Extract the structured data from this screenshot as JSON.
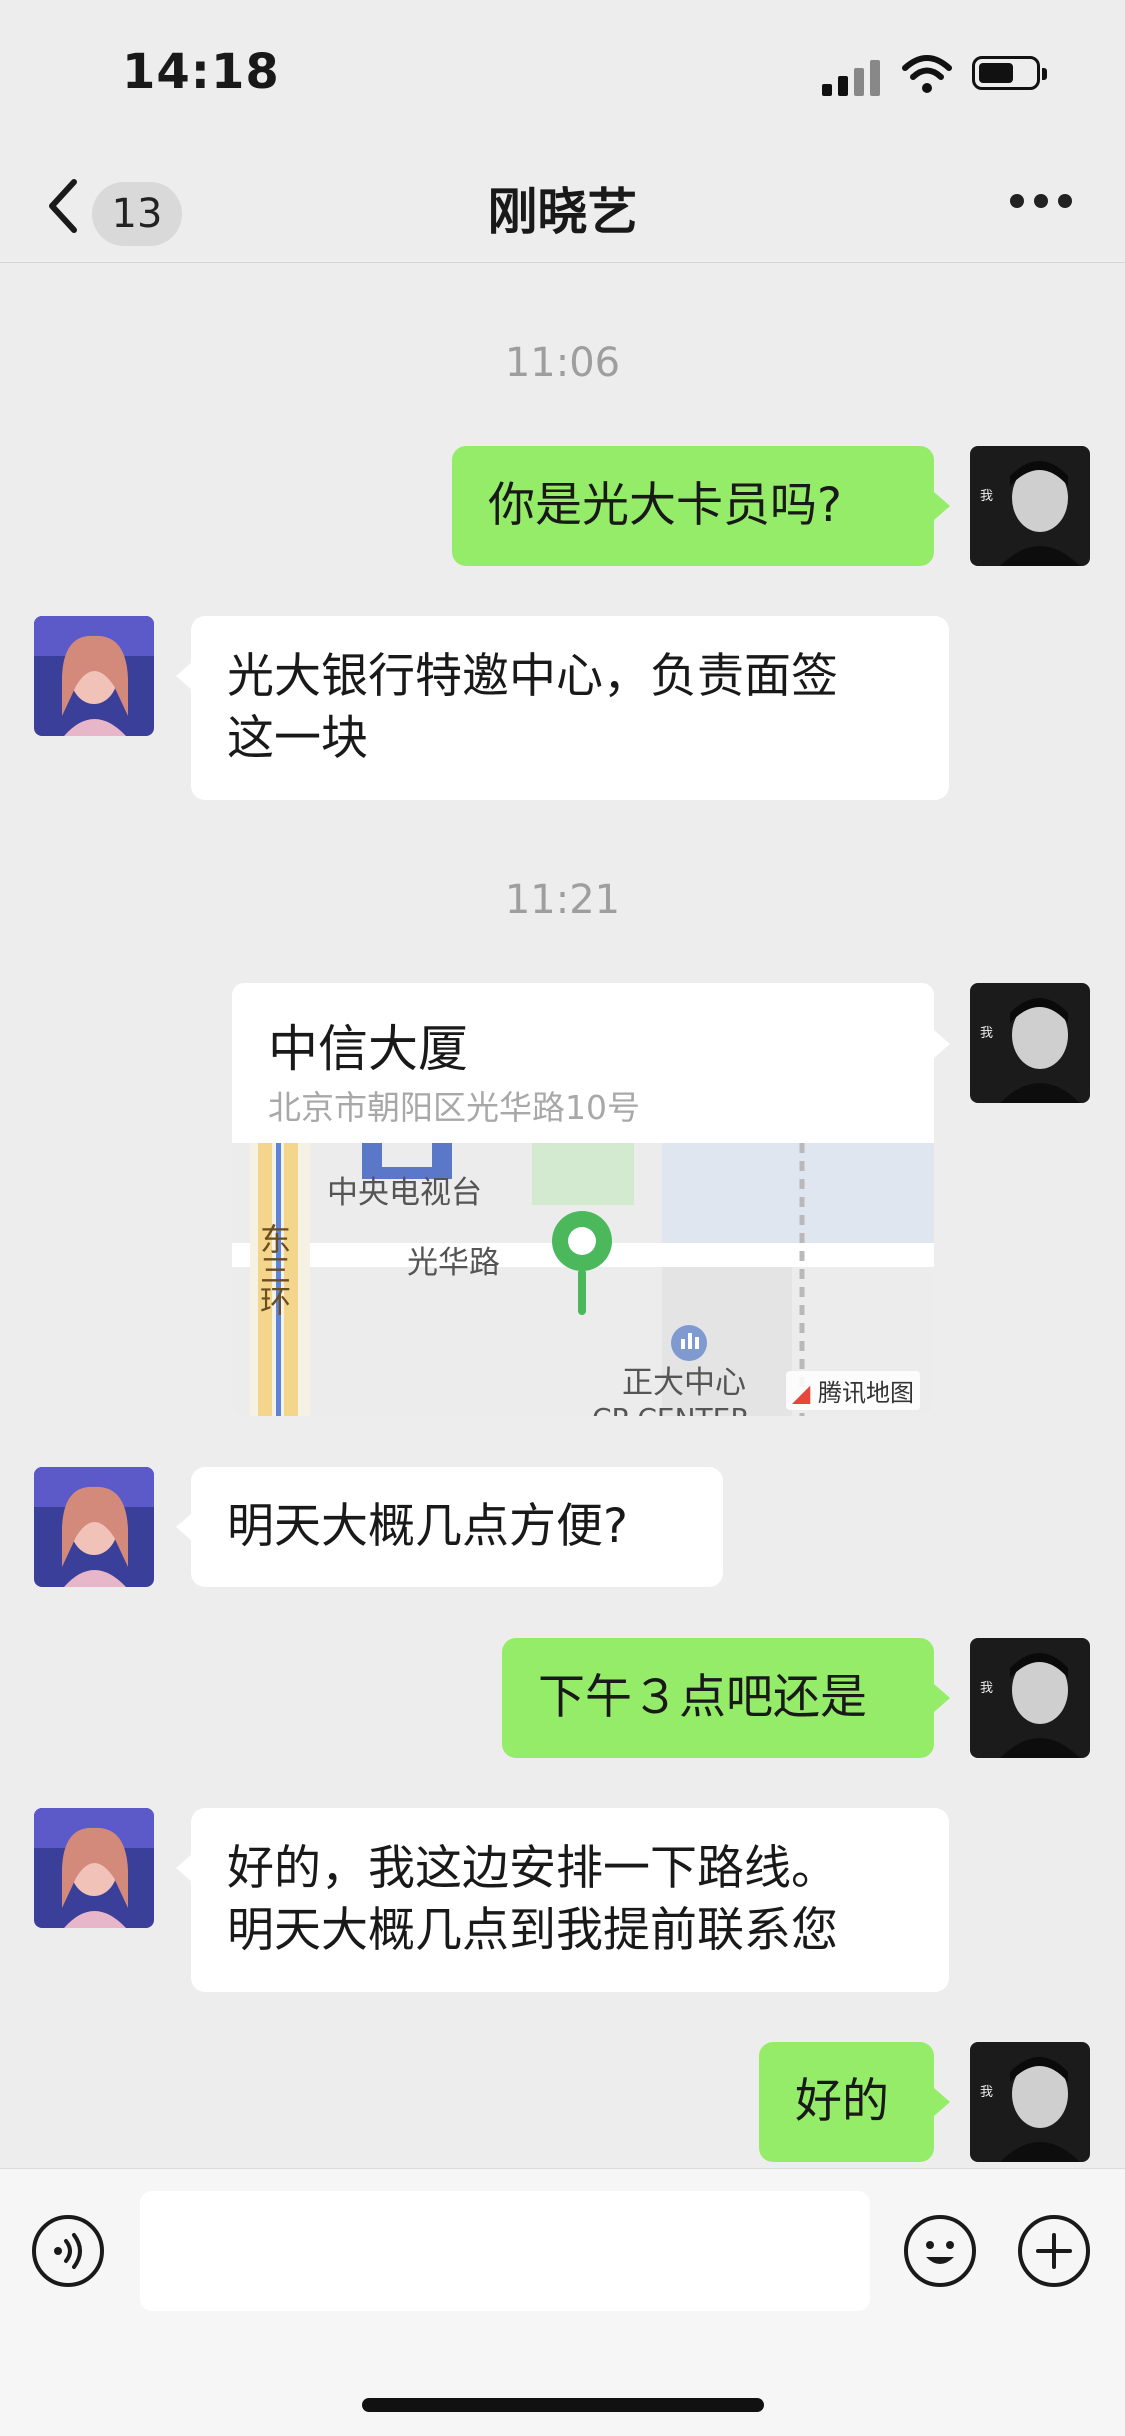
{
  "status_bar": {
    "time": "14:18"
  },
  "header": {
    "back_count": "13",
    "title": "刚晓艺"
  },
  "messages": {
    "ts1": "11:06",
    "m1": "你是光大卡员吗?",
    "m2_line1": "光大银行特邀中心，负责面签",
    "m2_line2": "这一块",
    "ts2": "11:21",
    "m4": "明天大概几点方便?",
    "m5": "下午３点吧还是",
    "m6_line1": "好的，我这边安排一下路线。",
    "m6_line2": "明天大概几点到我提前联系您",
    "m7": "好的"
  },
  "location": {
    "name": "中信大厦",
    "address": "北京市朝阳区光华路10号",
    "map_labels": {
      "cctv": "中央电视台",
      "road": "光华路",
      "east_ring": "东三环",
      "mall": "正大中心",
      "mall_en": "CP CENTER"
    },
    "map_credit": "腾讯地图"
  },
  "input_bar": {
    "voice_icon": "voice-icon",
    "emoji_icon": "emoji-icon",
    "plus_icon": "plus-icon"
  },
  "colors": {
    "self_bubble": "#95ec69",
    "other_bubble": "#ffffff",
    "background": "#ededed",
    "pin": "#4cb85c"
  }
}
